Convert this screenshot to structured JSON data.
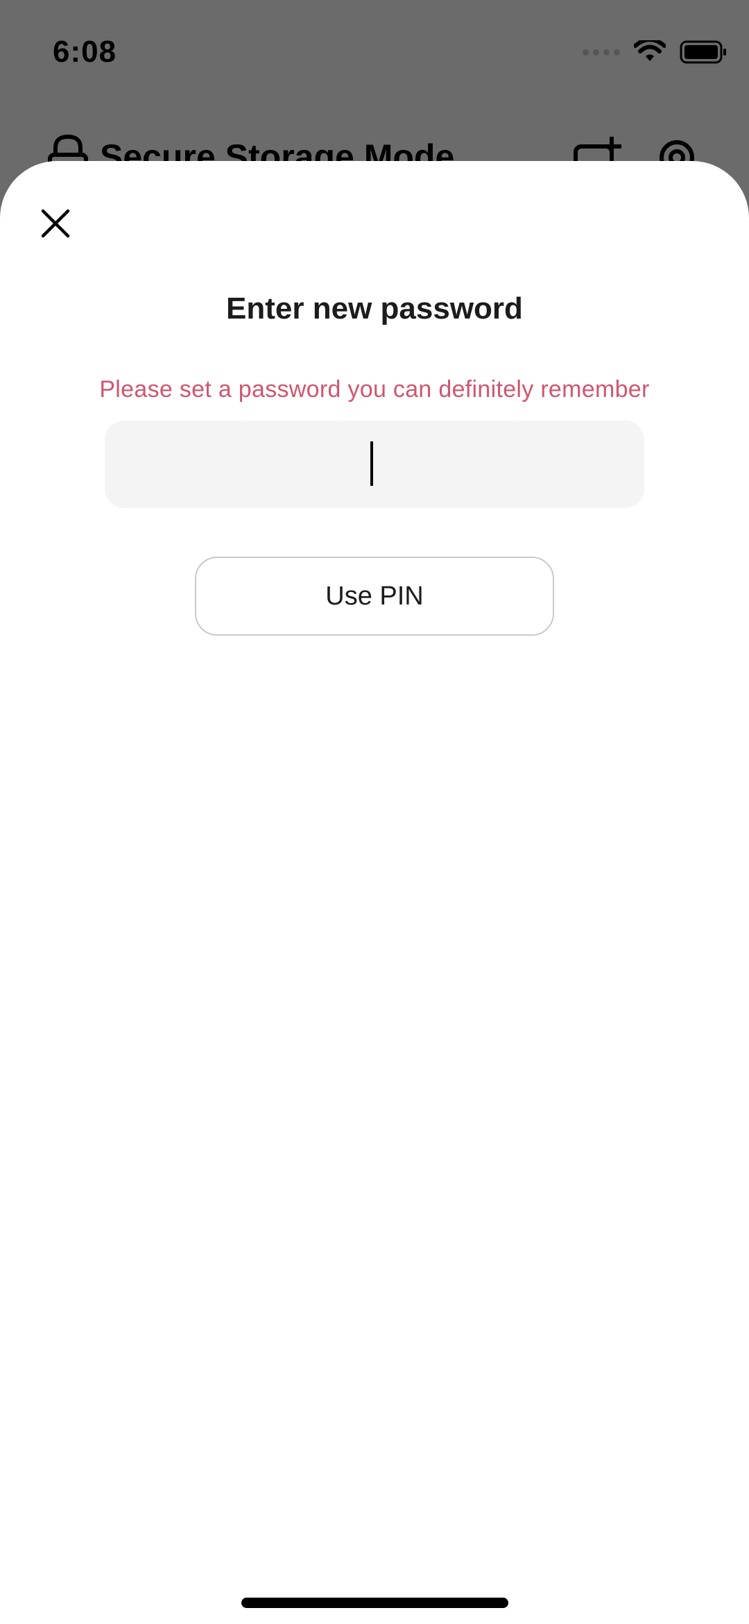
{
  "status_bar": {
    "time": "6:08",
    "icons": [
      "signal-dots-icon",
      "wifi-icon",
      "battery-icon"
    ]
  },
  "background_screen": {
    "title": "Secure Storage Mode",
    "icons": [
      "lock-icon",
      "add-folder-icon",
      "gear-icon"
    ]
  },
  "sheet": {
    "close_icon": "close-icon",
    "title": "Enter new password",
    "hint": "Please set a password you can definitely remember",
    "password_field": {
      "value": "",
      "placeholder": ""
    },
    "use_pin_label": "Use PIN"
  },
  "colors": {
    "hint": "#d0566f",
    "field_background": "#f4f4f4",
    "overlay": "#6b6b6b"
  }
}
